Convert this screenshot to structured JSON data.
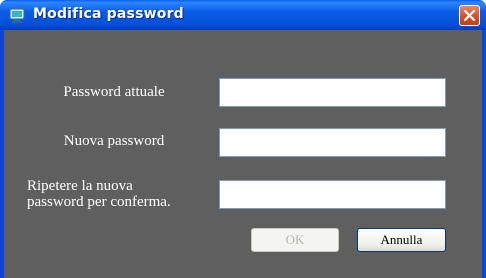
{
  "window": {
    "title": "Modifica password",
    "title_bar_color": "#0a5ee6",
    "close_button_color": "#d6542c",
    "client_background": "#5f5f5f"
  },
  "icons": {
    "app": "app-monitor-icon",
    "close": "close-icon"
  },
  "form": {
    "current_password": {
      "label": "Password attuale",
      "value": ""
    },
    "new_password": {
      "label": "Nuova password",
      "value": ""
    },
    "confirm_password": {
      "label_line1": "Ripetere la nuova",
      "label_line2": "password per conferma.",
      "value": ""
    }
  },
  "buttons": {
    "ok": {
      "label": "OK",
      "enabled": false
    },
    "cancel": {
      "label": "Annulla",
      "enabled": true
    }
  }
}
